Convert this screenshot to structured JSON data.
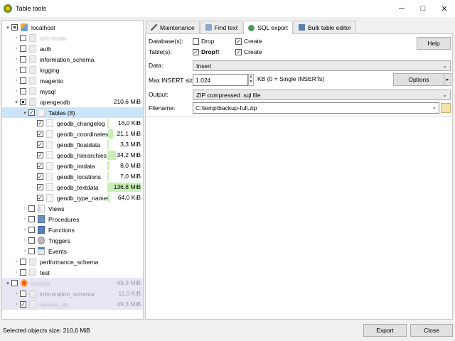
{
  "window": {
    "title": "Table tools",
    "minimize_glyph": "─",
    "maximize_glyph": "□",
    "close_glyph": "✕"
  },
  "tree": [
    {
      "label": "localhost",
      "size": "",
      "arrow": "▾",
      "check": "partial",
      "icon": "host"
    },
    {
      "label": "ahh-bruler",
      "size": "",
      "arrow": "›",
      "check": "",
      "icon": "db",
      "blur": true
    },
    {
      "label": "auth",
      "size": "",
      "arrow": "›",
      "check": "",
      "icon": "db"
    },
    {
      "label": "information_schema",
      "size": "",
      "arrow": "›",
      "check": "",
      "icon": "db"
    },
    {
      "label": "logging",
      "size": "",
      "arrow": "›",
      "check": "",
      "icon": "db"
    },
    {
      "label": "magento",
      "size": "",
      "arrow": "›",
      "check": "",
      "icon": "db"
    },
    {
      "label": "mysql",
      "size": "",
      "arrow": "›",
      "check": "",
      "icon": "db"
    },
    {
      "label": "opengeodb",
      "size": "210,6 MiB",
      "arrow": "▾",
      "check": "partial",
      "icon": "db"
    },
    {
      "label": "Tables (8)",
      "size": "",
      "arrow": "▾",
      "check": "✓",
      "icon": "folder",
      "selected": true
    },
    {
      "label": "geodb_changelog",
      "size": "16,0 KiB",
      "arrow": "",
      "check": "✓",
      "icon": "tbl",
      "bar": 0.01
    },
    {
      "label": "geodb_coordinates",
      "size": "21,1 MiB",
      "arrow": "",
      "check": "✓",
      "icon": "tbl",
      "bar": 0.15
    },
    {
      "label": "geodb_floatdata",
      "size": "3,3 MiB",
      "arrow": "",
      "check": "✓",
      "icon": "tbl",
      "bar": 0.02
    },
    {
      "label": "geodb_hierarchies",
      "size": "34,2 MiB",
      "arrow": "",
      "check": "✓",
      "icon": "tbl",
      "bar": 0.25
    },
    {
      "label": "geodb_intdata",
      "size": "8,0 MiB",
      "arrow": "",
      "check": "✓",
      "icon": "tbl",
      "bar": 0.06
    },
    {
      "label": "geodb_locations",
      "size": "7,0 MiB",
      "arrow": "",
      "check": "✓",
      "icon": "tbl",
      "bar": 0.05
    },
    {
      "label": "geodb_textdata",
      "size": "136,8 MiB",
      "arrow": "",
      "check": "✓",
      "icon": "tbl",
      "bar": 1.0
    },
    {
      "label": "geodb_type_names",
      "size": "64,0 KiB",
      "arrow": "",
      "check": "✓",
      "icon": "tbl",
      "bar": 0.01
    },
    {
      "label": "Views",
      "size": "",
      "arrow": "›",
      "check": "",
      "icon": "view"
    },
    {
      "label": "Procedures",
      "size": "",
      "arrow": "›",
      "check": "",
      "icon": "proc"
    },
    {
      "label": "Functions",
      "size": "",
      "arrow": "›",
      "check": "",
      "icon": "func"
    },
    {
      "label": "Triggers",
      "size": "",
      "arrow": "›",
      "check": "",
      "icon": "trig"
    },
    {
      "label": "Events",
      "size": "",
      "arrow": "›",
      "check": "",
      "icon": "evt"
    },
    {
      "label": "performance_schema",
      "size": "",
      "arrow": "›",
      "check": "",
      "icon": "db"
    },
    {
      "label": "test",
      "size": "",
      "arrow": "›",
      "check": "",
      "icon": "db"
    },
    {
      "label": "remote",
      "size": "49,3 MiB",
      "arrow": "▾",
      "check": "",
      "icon": "host2",
      "blur": true,
      "host2": true
    },
    {
      "label": "information_schema",
      "size": "11,0 KiB",
      "arrow": "›",
      "check": "",
      "icon": "db",
      "gray": true,
      "host2": true
    },
    {
      "label": "remote_db",
      "size": "49,3 MiB",
      "arrow": "›",
      "check": "✓",
      "icon": "db",
      "blur": true,
      "host2": true
    }
  ],
  "tabs": [
    {
      "label": "Maintenance",
      "icon": "wrench-icon"
    },
    {
      "label": "Find text",
      "icon": "find-icon"
    },
    {
      "label": "SQL export",
      "icon": "sql-export-icon",
      "active": true
    },
    {
      "label": "Bulk table editor",
      "icon": "bulk-edit-icon"
    }
  ],
  "form": {
    "databases_label": "Database(s):",
    "tables_label": "Table(s):",
    "drop_label": "Drop",
    "create_label": "Create",
    "drop_tables_label": "Drop!!",
    "create_tables_label": "Create",
    "db_drop_checked": "",
    "db_create_checked": "✓",
    "tbl_drop_checked": "✓",
    "tbl_create_checked": "✓",
    "help_button": "Help",
    "data_label": "Data:",
    "data_value": "Insert",
    "max_insert_label": "Max INSERT size:",
    "max_insert_value": "1.024",
    "max_insert_hint": "KB (0 = Single INSERTs)",
    "options_button": "Options",
    "output_label": "Output:",
    "output_value": "ZIP compressed .sql file",
    "filename_label": "Filename:",
    "filename_value": "C:\\temp\\backup-full.zip"
  },
  "status": {
    "selected_size": "Selected objects size: 210,6 MiB"
  },
  "buttons": {
    "export": "Export",
    "close": "Close"
  },
  "colors": {
    "size_bar": "#c7f0b6",
    "selection": "#cce4f7",
    "second_host_bg": "#e8e6f5"
  }
}
